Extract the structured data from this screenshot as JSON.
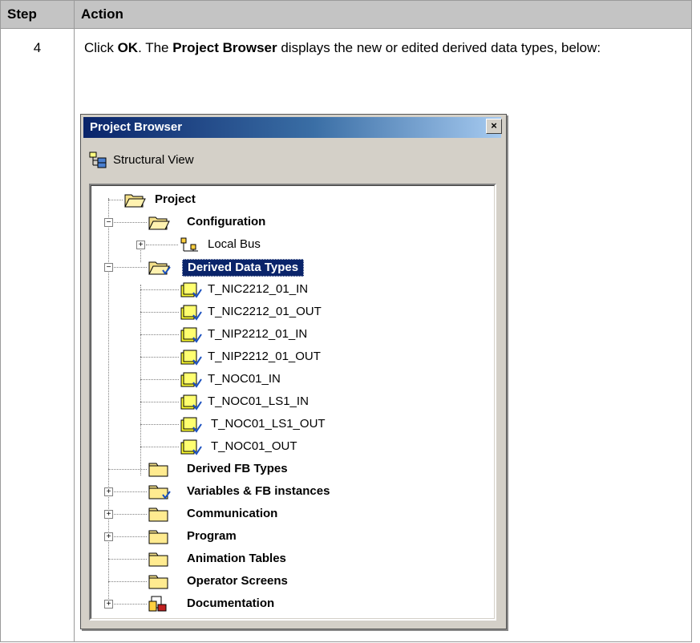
{
  "table": {
    "header_step": "Step",
    "header_action": "Action",
    "row": {
      "step": "4",
      "text_click": "Click ",
      "text_ok": "OK",
      "text_the": ". The ",
      "text_pb": "Project Browser",
      "text_rest": " displays the new or edited derived data types, below:"
    }
  },
  "window": {
    "title": "Project Browser",
    "close_glyph": "×",
    "view_label": "Structural View"
  },
  "tree": {
    "project": "Project",
    "configuration": "Configuration",
    "local_bus": "Local Bus",
    "derived_data_types": "Derived Data Types",
    "ddt_items": [
      "T_NIC2212_01_IN",
      "T_NIC2212_01_OUT",
      "T_NIP2212_01_IN",
      "T_NIP2212_01_OUT",
      "T_NOC01_IN",
      "T_NOC01_LS1_IN",
      "T_NOC01_LS1_OUT",
      "T_NOC01_OUT"
    ],
    "derived_fb_types": "Derived FB Types",
    "variables": "Variables & FB instances",
    "communication": "Communication",
    "program": "Program",
    "animation_tables": "Animation Tables",
    "operator_screens": "Operator Screens",
    "documentation": "Documentation"
  }
}
